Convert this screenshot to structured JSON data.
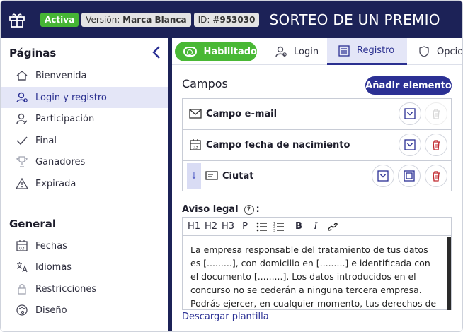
{
  "header": {
    "status": "Activa",
    "version_prefix": "Versión:",
    "version_value": "Marca Blanca",
    "id_prefix": "ID:",
    "id_value": "#953030",
    "title": "SORTEO DE UN PREMIO"
  },
  "sidebar": {
    "section1": "Páginas",
    "pages": [
      {
        "label": "Bienvenida",
        "icon": "home-icon"
      },
      {
        "label": "Login y registro",
        "icon": "user-icon"
      },
      {
        "label": "Participación",
        "icon": "user-edit-icon"
      },
      {
        "label": "Final",
        "icon": "check-icon"
      },
      {
        "label": "Ganadores",
        "icon": "trophy-icon"
      },
      {
        "label": "Expirada",
        "icon": "warning-icon"
      }
    ],
    "section2": "General",
    "general": [
      {
        "label": "Fechas",
        "icon": "calendar-icon"
      },
      {
        "label": "Idiomas",
        "icon": "translate-icon"
      },
      {
        "label": "Restricciones",
        "icon": "lock-icon"
      },
      {
        "label": "Diseño",
        "icon": "palette-icon"
      }
    ]
  },
  "tabs": {
    "toggle_label": "Habilitado",
    "items": [
      {
        "label": "Login",
        "icon": "user-icon"
      },
      {
        "label": "Registro",
        "icon": "form-icon"
      },
      {
        "label": "Opcio",
        "icon": "shield-icon"
      }
    ]
  },
  "main": {
    "section_title": "Campos",
    "add_button": "Añadir elemento",
    "fields": [
      {
        "label": "Campo e-mail",
        "icon": "envelope-icon"
      },
      {
        "label": "Campo fecha de nacimiento",
        "icon": "calendar-icon"
      },
      {
        "label": "Ciutat",
        "icon": "input-field-icon"
      }
    ],
    "aviso_label": "Aviso legal",
    "aviso_help": "?",
    "aviso_colon": ":",
    "toolbar": [
      "H1",
      "H2",
      "H3",
      "P"
    ],
    "legal_text": "La empresa responsable del tratamiento de tus datos es [.........], con domicilio en [.........] e identificada con el documento [.........]. Los datos introducidos en el concurso no se cederán a ninguna tercera empresa. Podrás ejercer, en cualquier momento, tus derechos de acceso, rectificación, supresión, oposición, limitación, portabilidad y",
    "download_link": "Descargar plantilla"
  },
  "colors": {
    "header_bg": "#1c2257",
    "active_green": "#46b535",
    "accent": "#2b3094",
    "delete_red": "#c0272d"
  }
}
